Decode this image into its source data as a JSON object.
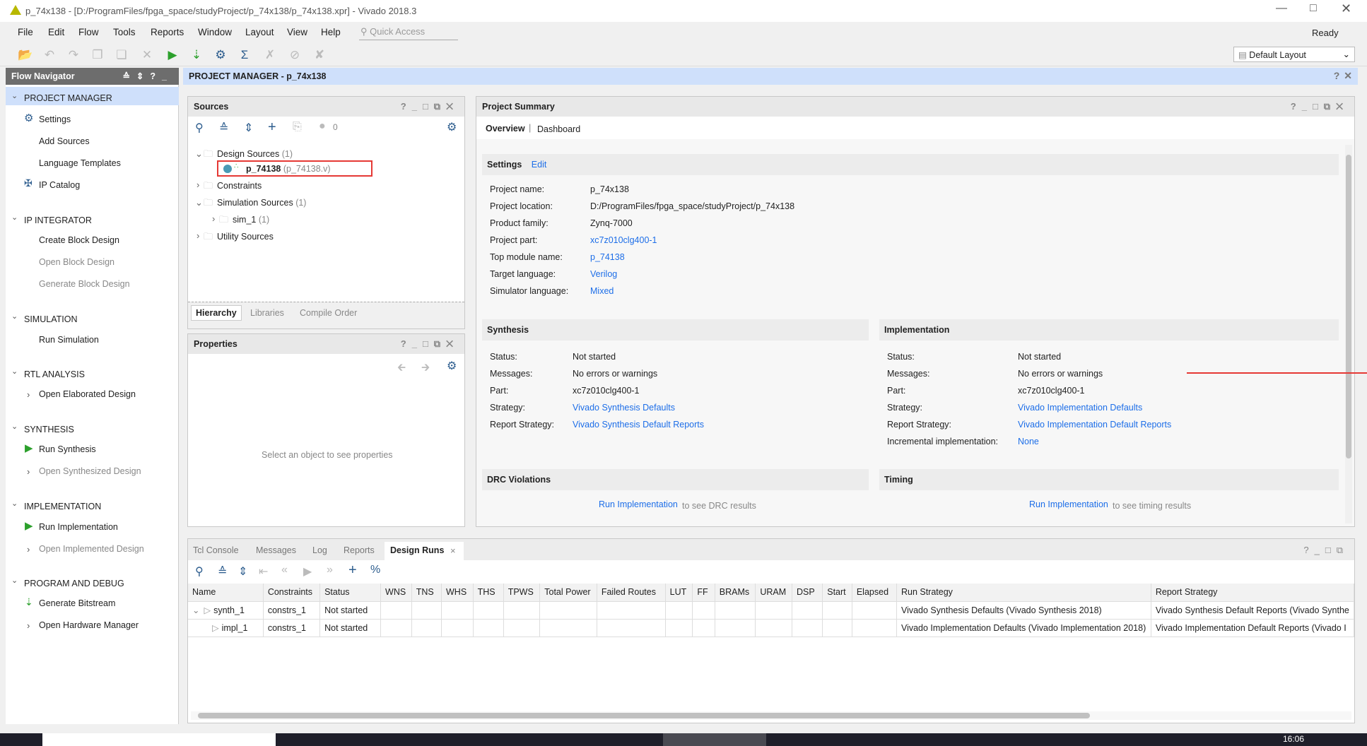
{
  "window": {
    "title": "p_74x138 - [D:/ProgramFiles/fpga_space/studyProject/p_74x138/p_74x138.xpr] - Vivado 2018.3",
    "status": "Ready",
    "layout_select": "Default Layout"
  },
  "menu": [
    "File",
    "Edit",
    "Flow",
    "Tools",
    "Reports",
    "Window",
    "Layout",
    "View",
    "Help"
  ],
  "quick_access": {
    "placeholder": "Quick Access"
  },
  "nav": {
    "title": "Flow Navigator",
    "sections": [
      {
        "label": "PROJECT MANAGER",
        "items": [
          "Settings",
          "Add Sources",
          "Language Templates",
          "IP Catalog"
        ]
      },
      {
        "label": "IP INTEGRATOR",
        "items": [
          "Create Block Design",
          "Open Block Design",
          "Generate Block Design"
        ]
      },
      {
        "label": "SIMULATION",
        "items": [
          "Run Simulation"
        ]
      },
      {
        "label": "RTL ANALYSIS",
        "items": [
          "Open Elaborated Design"
        ]
      },
      {
        "label": "SYNTHESIS",
        "items": [
          "Run Synthesis",
          "Open Synthesized Design"
        ]
      },
      {
        "label": "IMPLEMENTATION",
        "items": [
          "Run Implementation",
          "Open Implemented Design"
        ]
      },
      {
        "label": "PROGRAM AND DEBUG",
        "items": [
          "Generate Bitstream",
          "Open Hardware Manager"
        ]
      }
    ]
  },
  "main": {
    "title": "PROJECT MANAGER - p_74x138"
  },
  "sources": {
    "title": "Sources",
    "msg_count": "0",
    "tree": [
      {
        "label": "Design Sources",
        "count": "(1)"
      },
      {
        "label": "p_74138",
        "file": "(p_74138.v)"
      },
      {
        "label": "Constraints"
      },
      {
        "label": "Simulation Sources",
        "count": "(1)"
      },
      {
        "label": "sim_1",
        "count": "(1)"
      },
      {
        "label": "Utility Sources"
      }
    ],
    "tabs": [
      "Hierarchy",
      "Libraries",
      "Compile Order"
    ]
  },
  "properties": {
    "title": "Properties",
    "empty": "Select an object to see properties"
  },
  "summary": {
    "title": "Project Summary",
    "tabs": [
      "Overview",
      "Dashboard"
    ],
    "settings": {
      "title": "Settings",
      "edit": "Edit",
      "rows": [
        [
          "Project name:",
          "p_74x138"
        ],
        [
          "Project location:",
          "D:/ProgramFiles/fpga_space/studyProject/p_74x138"
        ],
        [
          "Product family:",
          "Zynq-7000"
        ],
        [
          "Project part:",
          "xc7z010clg400-1"
        ],
        [
          "Top module name:",
          "p_74138"
        ],
        [
          "Target language:",
          "Verilog"
        ],
        [
          "Simulator language:",
          "Mixed"
        ]
      ]
    },
    "synthesis": {
      "title": "Synthesis",
      "rows": [
        [
          "Status:",
          "Not started"
        ],
        [
          "Messages:",
          "No errors or warnings"
        ],
        [
          "Part:",
          "xc7z010clg400-1"
        ],
        [
          "Strategy:",
          "Vivado Synthesis Defaults"
        ],
        [
          "Report Strategy:",
          "Vivado Synthesis Default Reports"
        ]
      ]
    },
    "implementation": {
      "title": "Implementation",
      "rows": [
        [
          "Status:",
          "Not started"
        ],
        [
          "Messages:",
          "No errors or warnings"
        ],
        [
          "Part:",
          "xc7z010clg400-1"
        ],
        [
          "Strategy:",
          "Vivado Implementation Defaults"
        ],
        [
          "Report Strategy:",
          "Vivado Implementation Default Reports"
        ],
        [
          "Incremental implementation:",
          "None"
        ]
      ]
    },
    "drc": {
      "title": "DRC Violations",
      "link": "Run Implementation",
      "text": "to see DRC results"
    },
    "timing": {
      "title": "Timing",
      "link": "Run Implementation",
      "text": "to see timing results"
    }
  },
  "bottom": {
    "tabs": [
      "Tcl Console",
      "Messages",
      "Log",
      "Reports",
      "Design Runs"
    ],
    "columns": [
      "Name",
      "Constraints",
      "Status",
      "WNS",
      "TNS",
      "WHS",
      "THS",
      "TPWS",
      "Total Power",
      "Failed Routes",
      "LUT",
      "FF",
      "BRAMs",
      "URAM",
      "DSP",
      "Start",
      "Elapsed",
      "Run Strategy",
      "Report Strategy"
    ],
    "rows": [
      [
        "synth_1",
        "constrs_1",
        "Not started",
        "",
        "",
        "",
        "",
        "",
        "",
        "",
        "",
        "",
        "",
        "",
        "",
        "",
        "",
        "Vivado Synthesis Defaults (Vivado Synthesis 2018)",
        "Vivado Synthesis Default Reports (Vivado Synthe"
      ],
      [
        "impl_1",
        "constrs_1",
        "Not started",
        "",
        "",
        "",
        "",
        "",
        "",
        "",
        "",
        "",
        "",
        "",
        "",
        "",
        "",
        "Vivado Implementation Defaults (Vivado Implementation 2018)",
        "Vivado Implementation Default Reports (Vivado I"
      ]
    ]
  },
  "taskbar": {
    "clock": "16:06"
  },
  "colors": {
    "accent": "#1d6ee8",
    "highlight_box": "#e53935",
    "nav_selected": "#cfe0fb"
  }
}
